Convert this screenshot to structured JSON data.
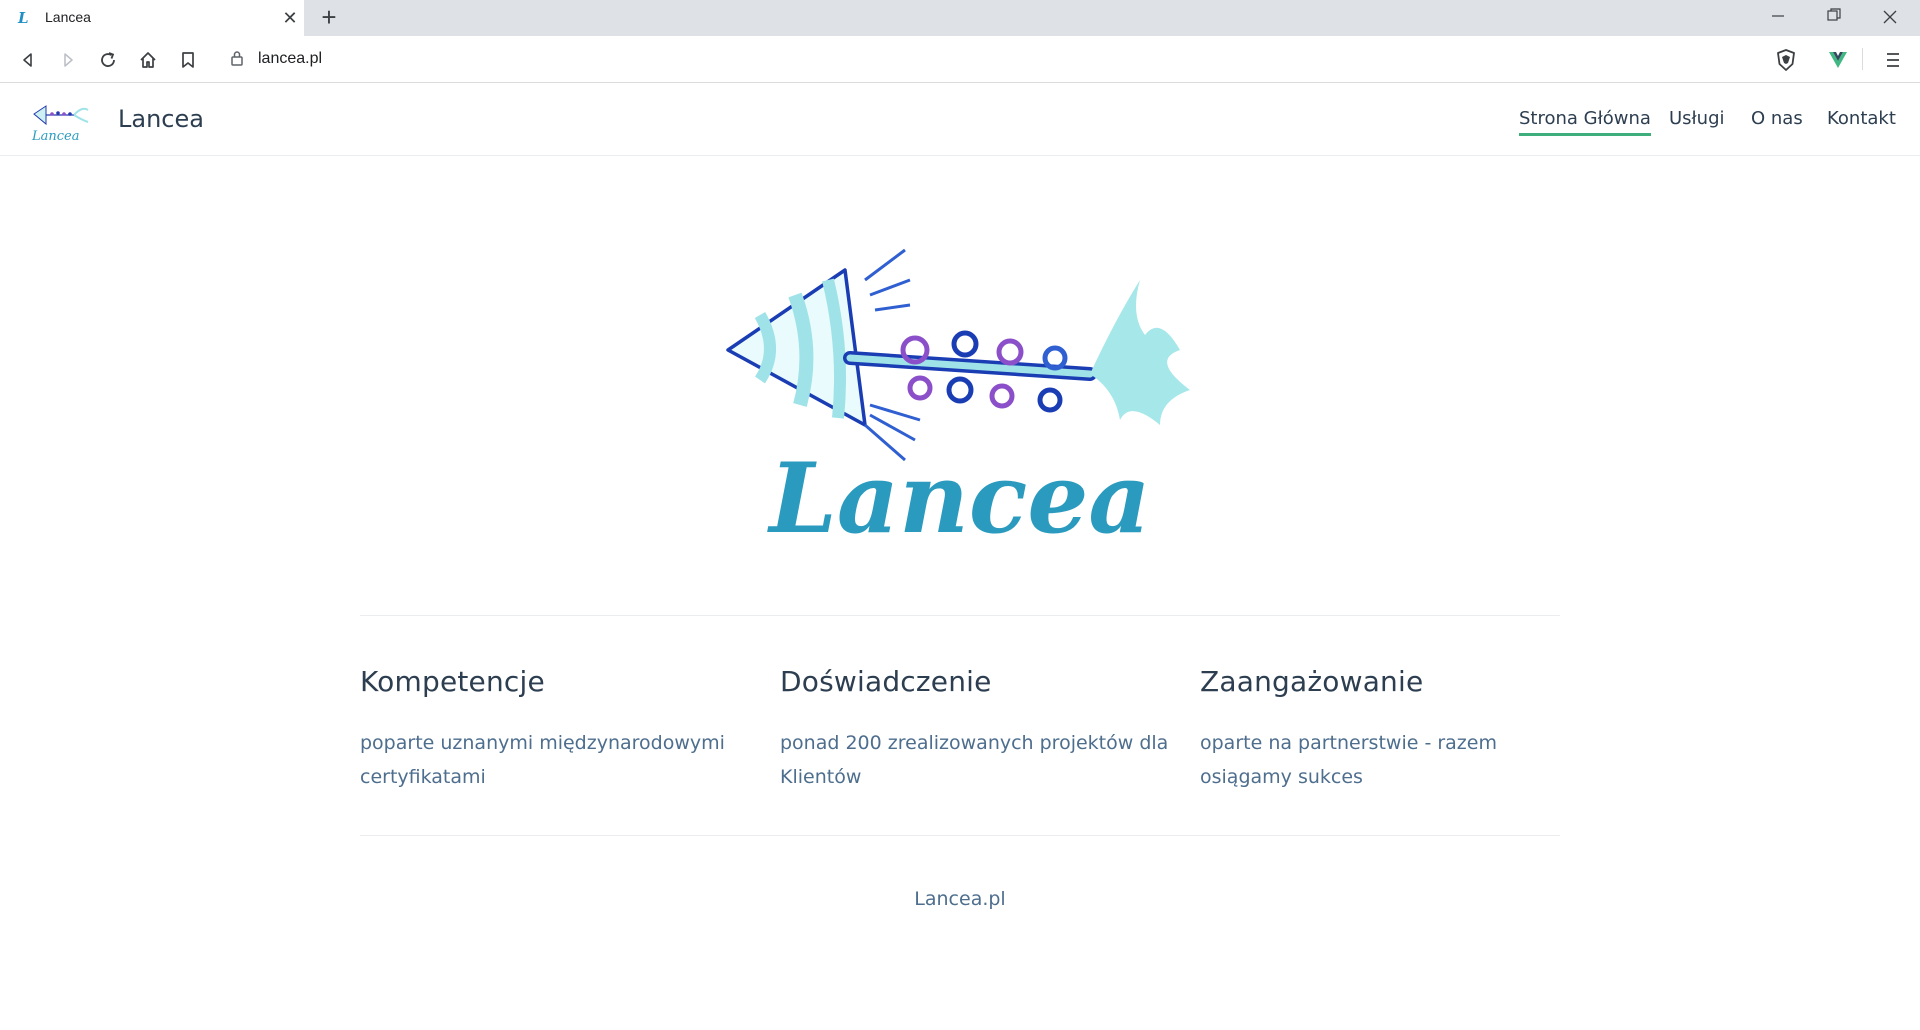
{
  "browser": {
    "tab_title": "Lancea",
    "tab_favicon": "L",
    "url": "lancea.pl",
    "icons": [
      "back-icon",
      "forward-icon",
      "reload-icon",
      "home-icon",
      "bookmark-icon",
      "lock-icon",
      "brave-shield-icon",
      "vue-devtools-icon",
      "menu-icon"
    ]
  },
  "site": {
    "brand": "Lancea",
    "nav": {
      "home": "Strona Główna",
      "services": "Usługi",
      "about": "O nas",
      "contact": "Kontakt"
    },
    "hero_logo_text": "Lancea",
    "features": [
      {
        "title": "Kompetencje",
        "details": "poparte uznanymi międzynarodowymi certyfikatami"
      },
      {
        "title": "Doświadczenie",
        "details": "ponad 200 zrealizowanych projektów dla Klientów"
      },
      {
        "title": "Zaangażowanie",
        "details": "oparte na partnerstwie - razem osiągamy sukces"
      }
    ],
    "footer": "Lancea.pl"
  },
  "colors": {
    "accent": "#3eaf7c",
    "text_dark": "#2c3e50",
    "text_muted": "#4e6e8e",
    "logo_teal": "#2a9bbf",
    "logo_blue": "#1b3db4",
    "logo_light": "#9fe3e8",
    "logo_purple": "#8b4fc9"
  }
}
